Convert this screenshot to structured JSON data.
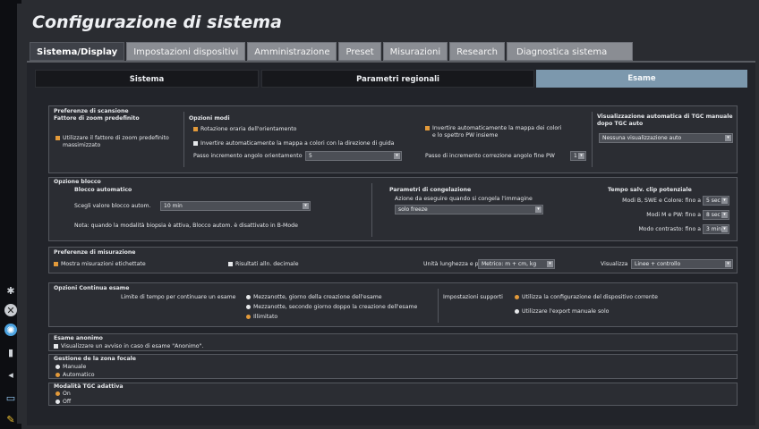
{
  "app": {
    "title": "Configurazione di sistema"
  },
  "tabs": [
    {
      "label": "Sistema/Display"
    },
    {
      "label": "Impostazioni dispositivi"
    },
    {
      "label": "Amministrazione"
    },
    {
      "label": "Preset"
    },
    {
      "label": "Misurazioni"
    },
    {
      "label": "Research"
    },
    {
      "label": "Diagnostica sistema"
    }
  ],
  "subtabs": [
    {
      "label": "Sistema"
    },
    {
      "label": "Parametri regionali"
    },
    {
      "label": "Esame"
    }
  ],
  "scan": {
    "title": "Preferenze di scansione",
    "zoom_title": "Fattore di zoom predefinito",
    "zoom_opt": "Utilizzare il fattore di zoom predefinito\nmassimizzato",
    "modes_title": "Opzioni modi",
    "rot": "Rotazione oraria dell'orientamento",
    "invert_guide": "Invertire automaticamente la mappa a colori con la direzione di guida",
    "angle_label": "Passo incremento angolo orientamento",
    "angle_value": "5",
    "invert_pw": "Invertire automaticamente la mappa dei colori\ne lo spettro PW insieme",
    "fine_label": "Passo di incremento correzione angolo fine PW",
    "fine_value": "1",
    "tgc_title": "Visualizzazione automatica di TGC manuale\ndopo TGC auto",
    "tgc_value": "Nessuna visualizzazione auto"
  },
  "lock": {
    "title": "Opzione blocco",
    "auto_title": "Blocco automatico",
    "choose_label": "Scegli valore blocco autom.",
    "choose_value": "10 min",
    "note": "Nota: quando la modalità biopsia è attiva, Blocco autom. è disattivato in B-Mode",
    "freeze_title": "Parametri di congelazione",
    "freeze_action": "Azione da eseguire quando si congela l'immagine",
    "freeze_value": "solo freeze",
    "clip_title": "Tempo salv. clip potenziale",
    "clip1_label": "Modi B, SWE e Colore: fino a",
    "clip1_value": "5 sec",
    "clip2_label": "Modi M e PW: fino a",
    "clip2_value": "8 sec",
    "clip3_label": "Modo contrasto: fino a",
    "clip3_value": "3 min"
  },
  "meas": {
    "title": "Preferenze di misurazione",
    "labeled": "Mostra misurazioni etichettate",
    "decimal": "Risultati alln. decimale",
    "unit_label": "Unità lunghezza e peso",
    "unit_value": "Metrico: m + cm, kg",
    "display_label": "Visualizza",
    "display_value": "Linee + controllo"
  },
  "continue": {
    "title": "Opzioni Continua esame",
    "limit_label": "Limite di tempo per continuare un esame",
    "opt1": "Mezzanotte, giorno della creazione dell'esame",
    "opt2": "Mezzanotte, secondo giorno doppo la creazione dell'esame",
    "opt3": "Illimitato",
    "supp_label": "Impostazioni supporti",
    "supp1": "Utilizza la configurazione del dispositivo corrente",
    "supp2": "Utilizzare l'export manuale solo"
  },
  "anon": {
    "title": "Esame anonimo",
    "opt": "Visualizzare un avviso in caso di esame \"Anonimo\"."
  },
  "focal": {
    "title": "Gestione de la zona focale",
    "opt1": "Manuale",
    "opt2": "Automatico"
  },
  "adaptive": {
    "title": "Modalità TGC adattiva",
    "opt1": "On",
    "opt2": "Off"
  },
  "colors": {
    "accent_orange": "#e39a3a",
    "selected_subtab": "#7c98ad",
    "tab_gray": "#8a8d93"
  }
}
